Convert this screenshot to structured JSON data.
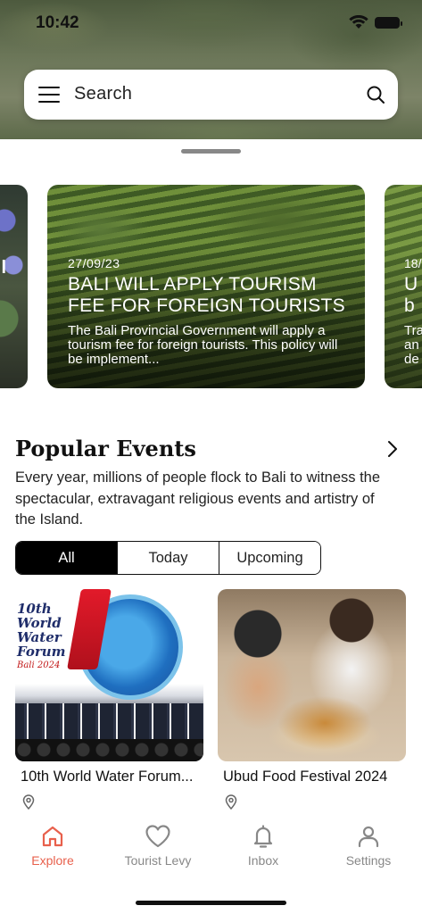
{
  "status_bar": {
    "time": "10:42"
  },
  "search": {
    "placeholder": "Search"
  },
  "news_cards": [
    {
      "side_text": "l"
    },
    {
      "date": "27/09/23",
      "title": "BALI WILL APPLY TOURISM FEE FOR FOREIGN TOURISTS",
      "body": "The Bali Provincial Government will apply a tourism fee for foreign tourists. This policy will be implement..."
    },
    {
      "date": "18/",
      "title": "U\nb",
      "body": "Tra\nan\nde"
    }
  ],
  "popular_events": {
    "title": "Popular Events",
    "description": "Every year, millions of people flock to Bali to witness the spectacular, extravagant religious events and artistry of the Island.",
    "filters": [
      "All",
      "Today",
      "Upcoming"
    ],
    "active_filter": "All",
    "events": [
      {
        "name": "10th World Water Forum...",
        "image_text": {
          "line1": "10th",
          "line2": "World",
          "line3": "Water",
          "line4": "Forum",
          "sub": "Bali 2024"
        }
      },
      {
        "name": "Ubud Food Festival 2024"
      }
    ]
  },
  "tabbar": {
    "tabs": [
      {
        "label": "Explore",
        "icon": "home-icon",
        "active": true
      },
      {
        "label": "Tourist Levy",
        "icon": "heart-icon",
        "active": false
      },
      {
        "label": "Inbox",
        "icon": "bell-icon",
        "active": false
      },
      {
        "label": "Settings",
        "icon": "user-icon",
        "active": false
      }
    ]
  },
  "colors": {
    "accent": "#e8604c",
    "inactive": "#888888",
    "active_filter_bg": "#000000"
  }
}
